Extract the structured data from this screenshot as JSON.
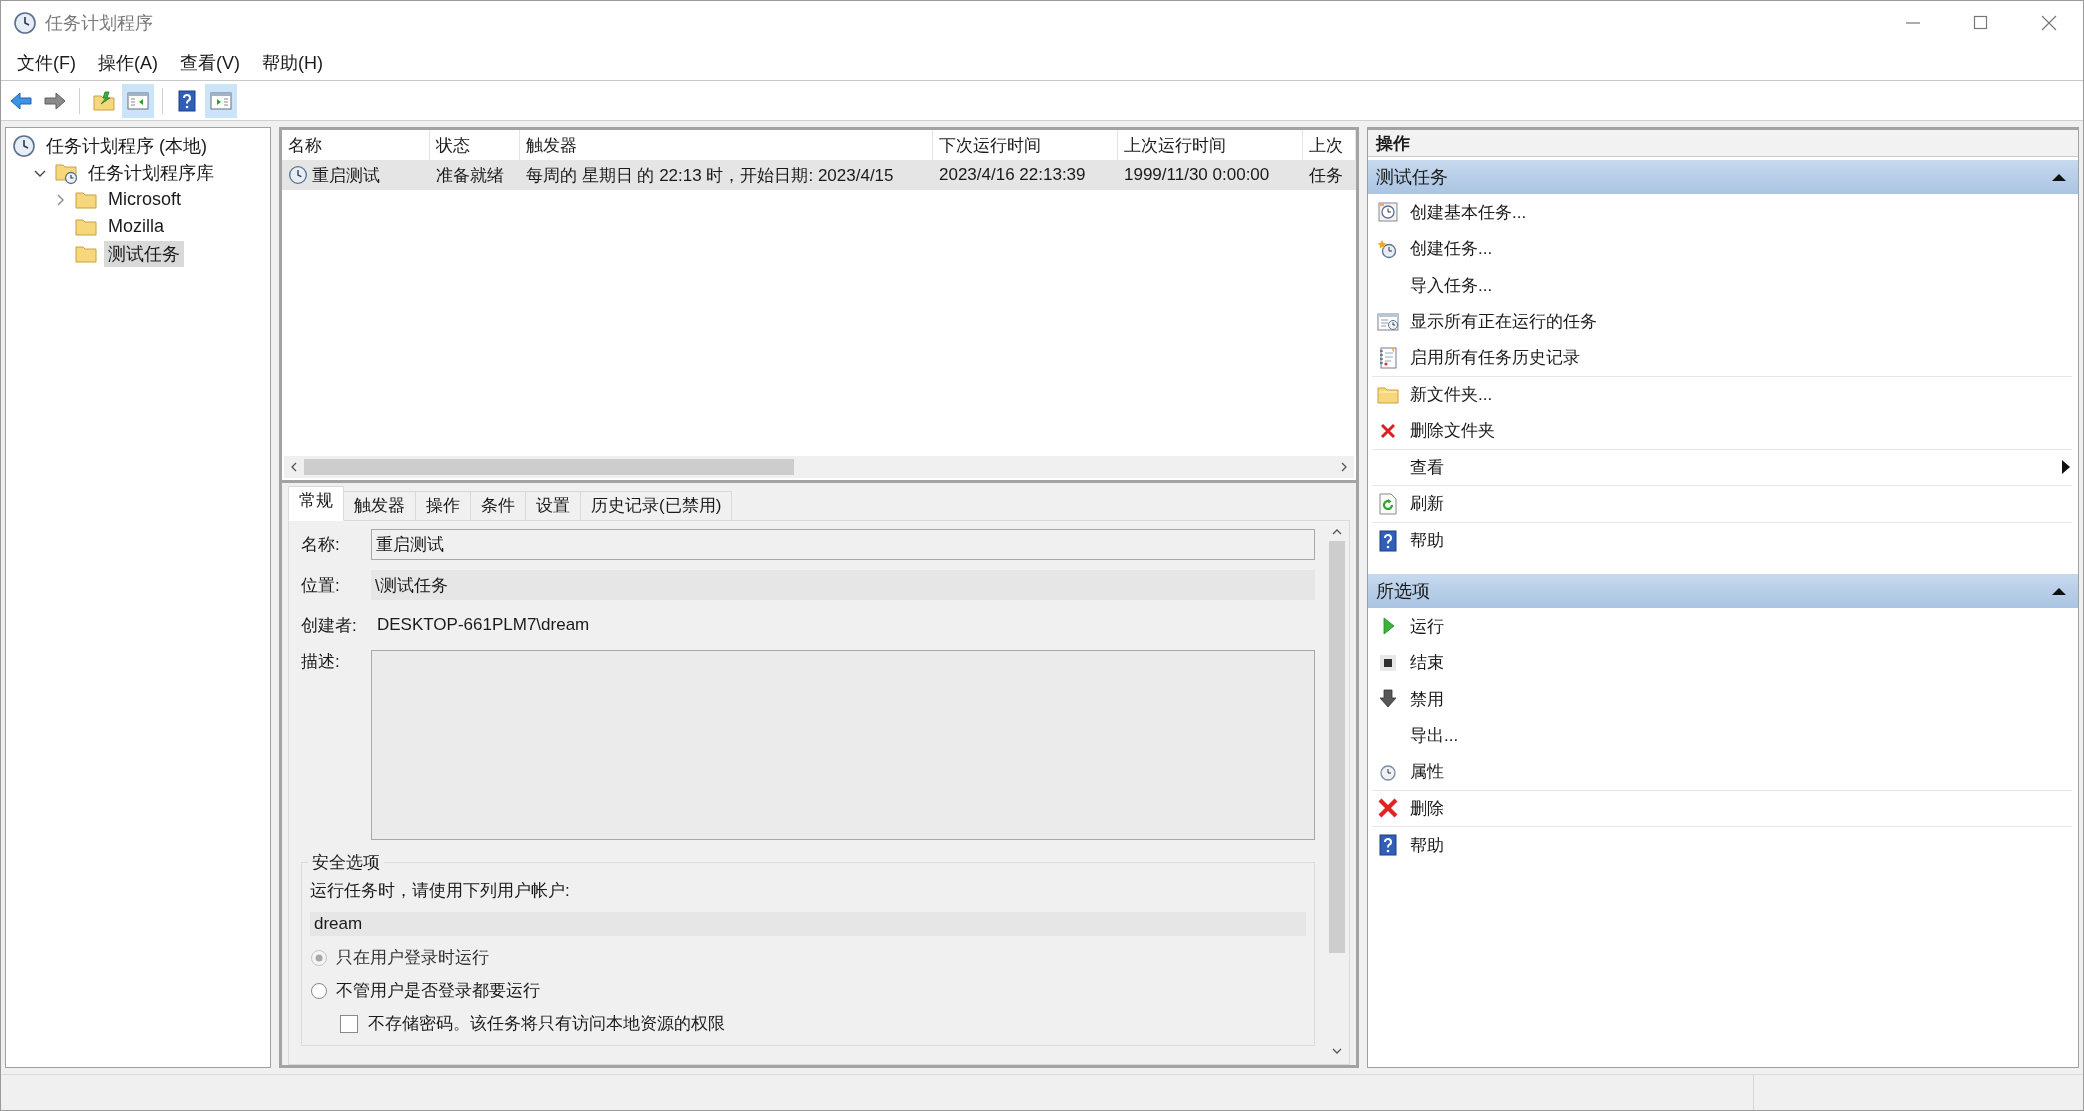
{
  "window": {
    "title": "任务计划程序"
  },
  "menu": [
    {
      "label": "文件(F)"
    },
    {
      "label": "操作(A)"
    },
    {
      "label": "查看(V)"
    },
    {
      "label": "帮助(H)"
    }
  ],
  "toolbar": [
    {
      "kind": "back",
      "pressed": false
    },
    {
      "kind": "forward",
      "pressed": false
    },
    {
      "kind": "up",
      "pressed": false
    },
    {
      "kind": "tree",
      "pressed": true
    },
    {
      "kind": "help",
      "pressed": false
    },
    {
      "kind": "pane",
      "pressed": true
    }
  ],
  "tree": [
    {
      "label": "任务计划程序 (本地)",
      "selected": false,
      "children": [
        {
          "label": "任务计划程序库",
          "selected": false,
          "expanded": true,
          "children": [
            {
              "label": "Microsoft",
              "selected": false,
              "expanded": false
            },
            {
              "label": "Mozilla",
              "selected": false
            },
            {
              "label": "测试任务",
              "selected": true
            }
          ]
        }
      ]
    }
  ],
  "table": {
    "columns": [
      "名称",
      "状态",
      "触发器",
      "下次运行时间",
      "上次运行时间",
      "上次"
    ],
    "rows": [
      {
        "selected": true,
        "cells": [
          "重启测试",
          "准备就绪",
          "每周的 星期日 的 22:13 时，开始日期: 2023/4/15",
          "2023/4/16 22:13:39",
          "1999/11/30 0:00:00",
          "任务"
        ]
      }
    ]
  },
  "detail": {
    "tabs": [
      {
        "label": "常规",
        "selected": true
      },
      {
        "label": "触发器",
        "selected": false
      },
      {
        "label": "操作",
        "selected": false
      },
      {
        "label": "条件",
        "selected": false
      },
      {
        "label": "设置",
        "selected": false
      },
      {
        "label": "历史记录(已禁用)",
        "selected": false
      }
    ],
    "fields": [
      {
        "label": "名称:",
        "value": "重启测试",
        "kind": "input"
      },
      {
        "label": "位置:",
        "value": "\\测试任务",
        "kind": "readonly"
      },
      {
        "label": "创建者:",
        "value": "DESKTOP-661PLM7\\dream",
        "kind": "plain"
      },
      {
        "label": "描述:",
        "kind": "textarea"
      }
    ],
    "security": {
      "title": "安全选项",
      "prompt": "运行任务时，请使用下列用户帐户:",
      "account": "dream",
      "options": [
        {
          "label": "只在用户登录时运行",
          "selected": true,
          "disabled": true
        },
        {
          "label": "不管用户是否登录都要运行",
          "selected": false,
          "disabled": false
        }
      ],
      "checkbox": {
        "label": "不存储密码。该任务将只有访问本地资源的权限",
        "checked": false
      }
    }
  },
  "actions": {
    "title": "操作",
    "groups": [
      {
        "title": "测试任务",
        "expanded": true,
        "items": [
          {
            "label": "创建基本任务...",
            "kind": "command",
            "divider": false
          },
          {
            "label": "创建任务...",
            "kind": "command",
            "divider": false
          },
          {
            "label": "导入任务...",
            "kind": "command",
            "divider": false
          },
          {
            "label": "显示所有正在运行的任务",
            "kind": "command",
            "divider": false
          },
          {
            "label": "启用所有任务历史记录",
            "kind": "command",
            "divider": true
          },
          {
            "label": "新文件夹...",
            "kind": "command",
            "divider": false
          },
          {
            "label": "删除文件夹",
            "kind": "command",
            "divider": true
          },
          {
            "label": "查看",
            "kind": "submenu",
            "divider": true
          },
          {
            "label": "刷新",
            "kind": "command",
            "divider": true
          },
          {
            "label": "帮助",
            "kind": "command",
            "divider": false
          }
        ]
      },
      {
        "title": "所选项",
        "expanded": true,
        "items": [
          {
            "label": "运行",
            "kind": "command",
            "divider": false
          },
          {
            "label": "结束",
            "kind": "command",
            "divider": false
          },
          {
            "label": "禁用",
            "kind": "command",
            "divider": false
          },
          {
            "label": "导出...",
            "kind": "command",
            "divider": false
          },
          {
            "label": "属性",
            "kind": "command",
            "divider": true
          },
          {
            "label": "删除",
            "kind": "command",
            "divider": true
          },
          {
            "label": "帮助",
            "kind": "command",
            "divider": false
          }
        ]
      }
    ]
  }
}
